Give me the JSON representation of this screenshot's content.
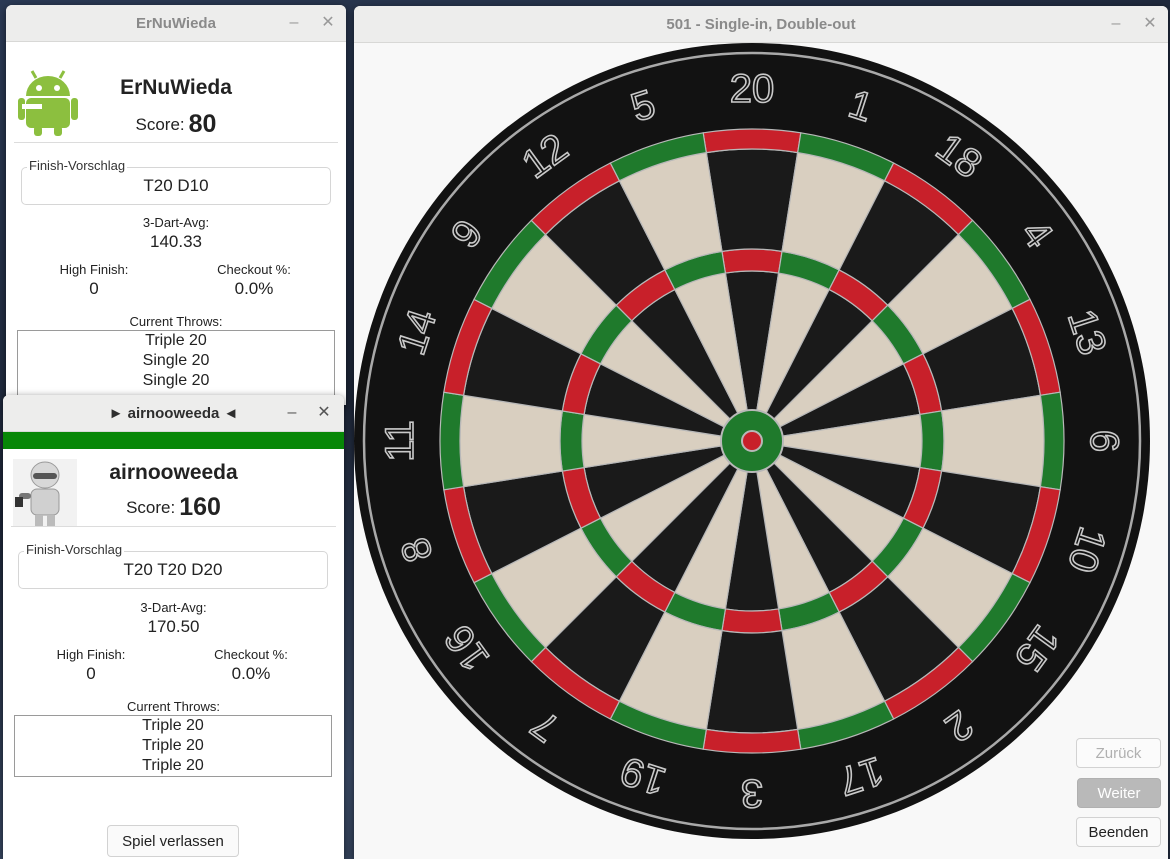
{
  "player1": {
    "window_title": "ErNuWieda",
    "name": "ErNuWieda",
    "score_label": "Score:",
    "score": "80",
    "finish_label": "Finish-Vorschlag",
    "finish": "T20 D10",
    "avg_label": "3-Dart-Avg:",
    "avg": "140.33",
    "high_finish_label": "High Finish:",
    "high_finish": "0",
    "checkout_label": "Checkout %:",
    "checkout": "0.0%",
    "throws_label": "Current Throws:",
    "throws": [
      "Triple 20",
      "Single 20",
      "Single 20"
    ],
    "avatar_icon": "android-robot-icon"
  },
  "player2": {
    "window_title": "► airnooweeda ◄",
    "name": "airnooweeda",
    "score_label": "Score:",
    "score": "160",
    "finish_label": "Finish-Vorschlag",
    "finish": "T20 T20 D20",
    "avg_label": "3-Dart-Avg:",
    "avg": "170.50",
    "high_finish_label": "High Finish:",
    "high_finish": "0",
    "checkout_label": "Checkout %:",
    "checkout": "0.0%",
    "throws_label": "Current Throws:",
    "throws": [
      "Triple 20",
      "Triple 20",
      "Triple 20"
    ],
    "leave_button": "Spiel verlassen",
    "active_color": "#078707",
    "avatar_icon": "robot-figure-icon"
  },
  "game": {
    "window_title": "501 - Single-in, Double-out",
    "board_numbers": [
      "20",
      "1",
      "18",
      "4",
      "13",
      "6",
      "10",
      "15",
      "2",
      "17",
      "3",
      "19",
      "7",
      "16",
      "8",
      "11",
      "14",
      "9",
      "12",
      "5"
    ],
    "buttons": {
      "back": "Zurück",
      "next": "Weiter",
      "end": "Beenden"
    },
    "colors": {
      "red": "#c8202a",
      "green": "#1f7a2c",
      "black": "#1a1a1a",
      "cream": "#d9cfc0"
    }
  },
  "window_controls": {
    "minimize": "–",
    "close": "✕"
  }
}
